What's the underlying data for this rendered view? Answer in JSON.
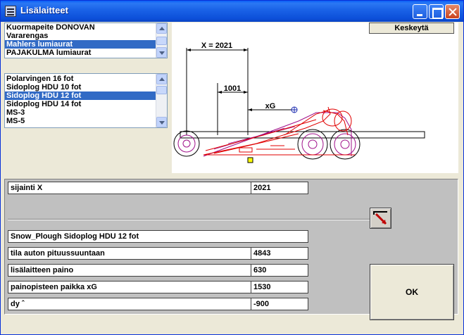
{
  "window": {
    "title": "Lisälaitteet"
  },
  "list_top": {
    "items": [
      {
        "label": "Kuormapeite DONOVAN"
      },
      {
        "label": "Vararengas"
      },
      {
        "label": "Mahlers lumiaurat"
      },
      {
        "label": "PAJAKULMA lumiaurat"
      }
    ],
    "selected_index": 2
  },
  "list_bottom": {
    "items": [
      {
        "label": "Polarvingen 16 fot"
      },
      {
        "label": "Sidoplog HDU 10 fot"
      },
      {
        "label": "Sidoplog HDU 12 fot"
      },
      {
        "label": "Sidoplog HDU 14 fot"
      },
      {
        "label": "MS-3"
      },
      {
        "label": "MS-5"
      }
    ],
    "selected_index": 2
  },
  "toolbar": {
    "cancel_label": "Keskeytä",
    "ok_label": "OK"
  },
  "drawing": {
    "dim_x_label": "X = 2021",
    "dim_1001_label": "1001",
    "xg_label": "xG"
  },
  "form": {
    "position_label": "sijainti  X",
    "position_value": "2021",
    "equipment_name": "Snow_Plough  Sidoplog HDU 12 fot",
    "space_label": "tila auton pituussuuntaan",
    "space_value": "4843",
    "weight_label": "lisälaitteen paino",
    "weight_value": "630",
    "cog_label": "painopisteen paikka  xG",
    "cog_value": "1530",
    "dy_label": "dy    ˆ",
    "dy_value": "-900"
  },
  "colors": {
    "selection": "#316ac5",
    "drawing_red": "#e00000",
    "drawing_purple": "#a0108a",
    "marker_yellow": "#ffff00"
  }
}
